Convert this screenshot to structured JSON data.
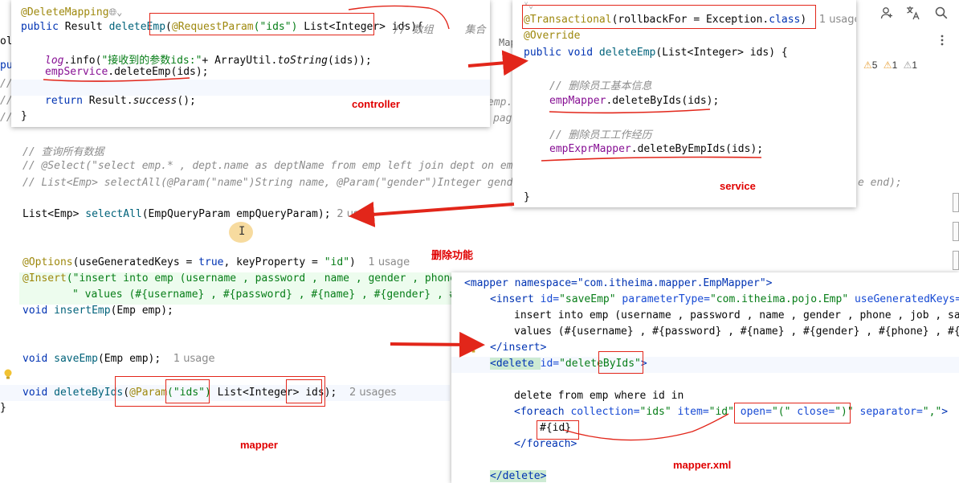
{
  "bg_editor": {
    "lines": {
      "l_colle": "olle",
      "l_pub": "pub",
      "l_c1": "//",
      "l_c2": "//",
      "l_c3": "//",
      "l_emp_frag": "emp.",
      "l_pag_frag": "pag",
      "l_query_cmt": "// 查询所有数据",
      "l_select_cmt": "// @Select(\"select emp.* , dept.name as deptName from emp left join dept on emp",
      "l_list_cmt": "// List<Emp> selectAll(@Param(\"name\")String name, @Param(\"gender\")Integer gende",
      "l_end_frag": "e end);",
      "l_selectall_a": "List<Emp> ",
      "l_selectall_fn": "selectAll",
      "l_selectall_b": "(EmpQueryParam empQueryParam);",
      "l_selectall_hint": "2 usa",
      "l_options_ann": "@Options",
      "l_options_a": "(useGeneratedKeys = ",
      "l_options_true": "true",
      "l_options_b": ", keyProperty = ",
      "l_options_str": "\"id\"",
      "l_options_c": ")",
      "l_options_hint": "1 usage",
      "l_insert_ann": "@Insert",
      "l_insert_str": "(\"insert into emp (username , password , name , gender , phone",
      "l_values_str": "\" values (#{username} , #{password} , #{name} , #{gender} , #",
      "l_insertemp_a": "void ",
      "l_insertemp_fn": "insertEmp",
      "l_insertemp_b": "(Emp emp);",
      "l_saveemp_a": "void ",
      "l_saveemp_fn": "saveEmp",
      "l_saveemp_b": "(Emp emp);",
      "l_saveemp_hint": "1 usage",
      "l_delete_a": "void ",
      "l_delete_fn": "deleteByIds",
      "l_delete_b": "(",
      "l_delete_ann": "@Param",
      "l_delete_str": "(\"ids\")",
      "l_delete_c": " List<Integer> ids);",
      "l_delete_hint": "2 usages",
      "l_close_brace": "}",
      "l_mappe": "Mappe"
    },
    "right_toolbar": {
      "warnings": "5",
      "weak": "1",
      "info": "1"
    }
  },
  "controller": {
    "lines": {
      "ann": "@DeleteMapping",
      "sig_a": "public ",
      "sig_b": "Result ",
      "sig_fn": "deleteEmp",
      "sig_c": "(",
      "sig_ann": "@RequestParam",
      "sig_str": "(\"ids\")",
      "sig_d": " List<Integer> ids){",
      "sig_cmt": "// 数组     集合",
      "log_a": "log",
      "log_b": ".info(",
      "log_str": "\"接收到的参数ids:\"",
      "log_c": "+ ArrayUtil.",
      "log_fn": "toString",
      "log_d": "(ids));",
      "svc_a": "empService",
      "svc_b": ".deleteEmp(ids);",
      "ret_a": "return ",
      "ret_b": "Result.",
      "ret_fn": "success",
      "ret_c": "();",
      "close": "}"
    },
    "label": "controller"
  },
  "service": {
    "lines": {
      "tx_ann": "@Transactional",
      "tx_a": "(rollbackFor = Exception.",
      "tx_kw": "class",
      "tx_b": ")",
      "tx_hint": "1 usage",
      "ov_ann": "@Override",
      "sig_kw": "public void ",
      "sig_fn": "deleteEmp",
      "sig_b": "(List<Integer> ids) {",
      "cmt1": "// 删除员工基本信息",
      "m1_a": "empMapper",
      "m1_b": ".deleteByIds(ids);",
      "cmt2": "// 删除员工工作经历",
      "m2_a": "empExprMapper",
      "m2_b": ".deleteByEmpIds(ids);",
      "close": "}"
    },
    "label": "service"
  },
  "center_label": "删除功能",
  "mapper_label": "mapper",
  "xml": {
    "lines": {
      "mapper_open": "<mapper namespace=\"com.itheima.mapper.EmpMapper\">",
      "insert_tag": "<insert ",
      "insert_attr1": "id=",
      "insert_val1": "\"saveEmp\"",
      "insert_attr2": " parameterType=",
      "insert_val2": "\"com.itheima.pojo.Emp\"",
      "insert_attr3": " useGeneratedKeys=",
      "insert_val3": "\"",
      "insert_sql1": "insert into emp (username , password , name , gender , phone , job , sal",
      "insert_sql2": "values (#{username} , #{password} , #{name} , #{gender} , #{phone} , #{",
      "insert_close": "</insert>",
      "delete_tag": "<delete ",
      "delete_attr": "id=",
      "delete_val": "\"deleteByIds\"",
      "delete_end": ">",
      "sql_delete": "delete from emp where id in",
      "fe_tag": "<foreach ",
      "fe_attr1": "collection=",
      "fe_val1": "\"ids\"",
      "fe_attr2": " item=",
      "fe_val2": "\"id\"",
      "fe_attr3": " open=",
      "fe_val3": "\"(\"",
      "fe_attr4": " close=",
      "fe_val4": "\")\"",
      "fe_attr5": " separator=",
      "fe_val5": "\",\"",
      "fe_end": ">",
      "fe_body": "#{id}",
      "fe_close": "</foreach>",
      "delete_close": "</delete>"
    },
    "label": "mapper.xml"
  },
  "colors": {
    "annotation_red": "#e2261a",
    "keyword": "#0033b3",
    "string": "#067d17",
    "comment": "#8c8c8c"
  },
  "icons": {
    "globe": "globe-icon",
    "user": "user-icon",
    "translate": "translate-icon",
    "search": "search-icon",
    "settings": "gear-icon"
  }
}
